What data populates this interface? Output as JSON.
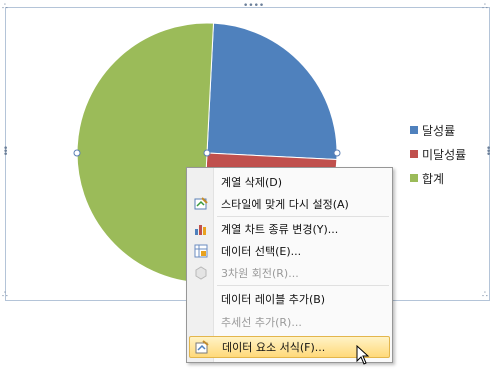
{
  "chart_data": {
    "type": "pie",
    "categories": [
      "달성률",
      "미달성률",
      "합계"
    ],
    "values": [
      25,
      25,
      50
    ],
    "colors": [
      "#4f81bd",
      "#c0504d",
      "#9bbb59"
    ],
    "legend_position": "right"
  },
  "legend": {
    "items": [
      {
        "label": "달성률",
        "color": "#4f81bd"
      },
      {
        "label": "미달성률",
        "color": "#c0504d"
      },
      {
        "label": "합계",
        "color": "#9bbb59"
      }
    ]
  },
  "context_menu": {
    "items": [
      {
        "label": "계열 삭제(D)",
        "icon": "none",
        "enabled": true
      },
      {
        "label": "스타일에 맞게 다시 설정(A)",
        "icon": "reset-style-icon",
        "enabled": true
      },
      {
        "label": "계열 차트 종류 변경(Y)...",
        "icon": "chart-type-icon",
        "enabled": true
      },
      {
        "label": "데이터 선택(E)...",
        "icon": "select-data-icon",
        "enabled": true
      },
      {
        "label": "3차원 회전(R)...",
        "icon": "3d-rotation-icon",
        "enabled": false
      },
      {
        "label": "데이터 레이블 추가(B)",
        "icon": "none",
        "enabled": true
      },
      {
        "label": "추세선 추가(R)...",
        "icon": "none",
        "enabled": false
      },
      {
        "label": "데이터 요소 서식(F)...",
        "icon": "format-data-point-icon",
        "enabled": true,
        "highlighted": true
      }
    ]
  }
}
